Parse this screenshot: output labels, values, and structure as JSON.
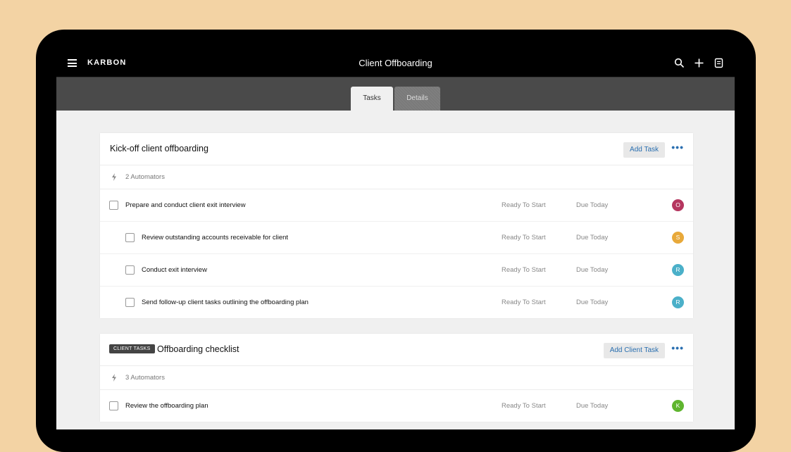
{
  "app": {
    "brand": "KARBON",
    "title": "Client Offboarding"
  },
  "tabs": [
    {
      "label": "Tasks",
      "active": true
    },
    {
      "label": "Details",
      "active": false
    }
  ],
  "sections": [
    {
      "title": "Kick-off client offboarding",
      "add_label": "Add Task",
      "automators": "2 Automators",
      "tasks": [
        {
          "name": "Prepare and conduct client exit interview",
          "status": "Ready To Start",
          "due": "Due Today",
          "assignee": "O",
          "color": "#b5365f"
        },
        {
          "name": "Review outstanding accounts receivable for client",
          "status": "Ready To Start",
          "due": "Due Today",
          "assignee": "S",
          "color": "#e8a93a"
        },
        {
          "name": "Conduct exit interview",
          "status": "Ready To Start",
          "due": "Due Today",
          "assignee": "R",
          "color": "#4bb0c9"
        },
        {
          "name": "Send follow-up client tasks outlining the offboarding plan",
          "status": "Ready To Start",
          "due": "Due Today",
          "assignee": "R",
          "color": "#4bb0c9"
        }
      ]
    },
    {
      "badge": "CLIENT TASKS",
      "title": "Offboarding checklist",
      "add_label": "Add Client Task",
      "automators": "3 Automators",
      "tasks": [
        {
          "name": "Review the offboarding plan",
          "status": "Ready To Start",
          "due": "Due Today",
          "assignee": "K",
          "color": "#5fb52f"
        }
      ]
    }
  ],
  "icons": {
    "menu": "hamburger-icon",
    "search": "search-icon",
    "add": "plus-icon",
    "notes": "notes-icon",
    "automators": "bolt-icon",
    "more": "more-dots-icon"
  }
}
